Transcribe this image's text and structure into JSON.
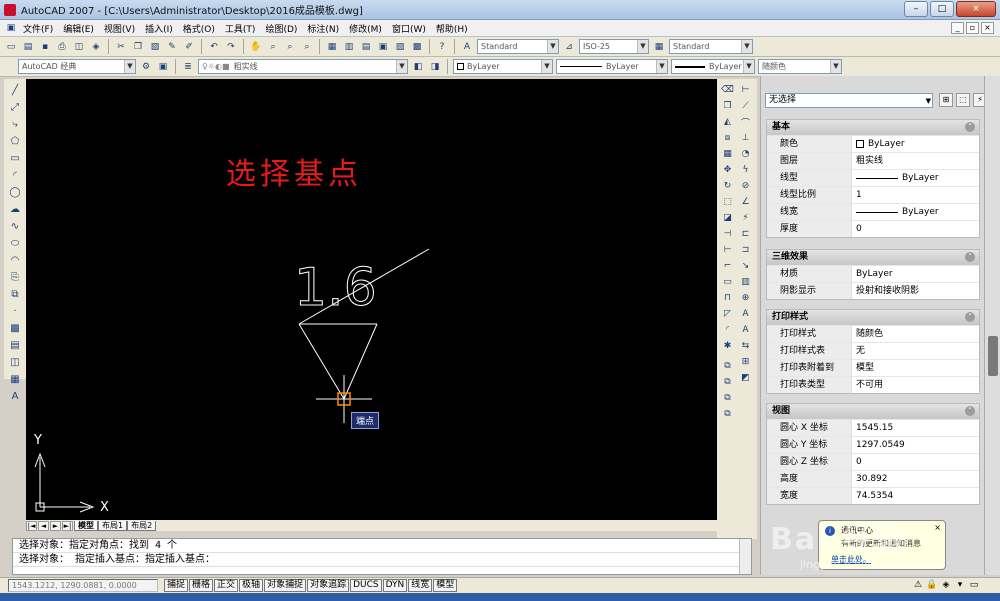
{
  "window": {
    "title": "AutoCAD 2007 - [C:\\Users\\Administrator\\Desktop\\2016成品模板.dwg]",
    "min": "–",
    "max": "□",
    "close": "×"
  },
  "menu": [
    "文件(F)",
    "编辑(E)",
    "视图(V)",
    "插入(I)",
    "格式(O)",
    "工具(T)",
    "绘图(D)",
    "标注(N)",
    "修改(M)",
    "窗口(W)",
    "帮助(H)"
  ],
  "mdi": {
    "min": "_",
    "restore": "▫",
    "close": "×"
  },
  "toolbar": {
    "text_style": "Standard",
    "dim_style": "ISO-25",
    "table_style": "Standard",
    "workspace": "AutoCAD 经典",
    "layer": "粗实线",
    "color": "ByLayer",
    "linetype": "ByLayer",
    "lineweight": "ByLayer",
    "plotstyle": "随颜色"
  },
  "canvas": {
    "overlay_text": "选择基点",
    "drawing_text": "1.6",
    "tooltip": "端点",
    "ucs_y": "Y",
    "ucs_x": "X"
  },
  "layout_tabs": {
    "nav": [
      "|◄",
      "◄",
      "►",
      "►|"
    ],
    "tabs": [
      "模型",
      "布局1",
      "布局2"
    ]
  },
  "command_lines": [
    "选择对象：指定对角点：找到 4 个",
    "选择对象：  指定插入基点：指定插入基点："
  ],
  "status": {
    "coords": "1543.1212, 1290.0881, 0.0000",
    "buttons": [
      "捕捉",
      "栅格",
      "正交",
      "极轴",
      "对象捕捉",
      "对象追踪",
      "DUCS",
      "DYN",
      "线宽",
      "模型"
    ]
  },
  "properties": {
    "selection": "无选择",
    "sections": [
      {
        "title": "基本",
        "rows": [
          {
            "k": "颜色",
            "v": "ByLayer",
            "type": "color"
          },
          {
            "k": "图层",
            "v": "粗实线"
          },
          {
            "k": "线型",
            "v": "ByLayer",
            "type": "line"
          },
          {
            "k": "线型比例",
            "v": "1"
          },
          {
            "k": "线宽",
            "v": "ByLayer",
            "type": "line"
          },
          {
            "k": "厚度",
            "v": "0"
          }
        ]
      },
      {
        "title": "三维效果",
        "rows": [
          {
            "k": "材质",
            "v": "ByLayer"
          },
          {
            "k": "阴影显示",
            "v": "投射和接收阴影"
          }
        ]
      },
      {
        "title": "打印样式",
        "rows": [
          {
            "k": "打印样式",
            "v": "随颜色"
          },
          {
            "k": "打印样式表",
            "v": "无"
          },
          {
            "k": "打印表附着到",
            "v": "模型"
          },
          {
            "k": "打印表类型",
            "v": "不可用"
          }
        ]
      },
      {
        "title": "视图",
        "rows": [
          {
            "k": "圆心 X 坐标",
            "v": "1545.15"
          },
          {
            "k": "圆心 Y 坐标",
            "v": "1297.0549"
          },
          {
            "k": "圆心 Z 坐标",
            "v": "0"
          },
          {
            "k": "高度",
            "v": "30.892"
          },
          {
            "k": "宽度",
            "v": "74.5354"
          }
        ]
      }
    ]
  },
  "notification": {
    "title": "通讯中心",
    "body": "有新的更新和通知消息",
    "link": "单击此处。",
    "close": "×"
  },
  "watermark": {
    "main": "Bai 经验",
    "sub": "jingyan.baidu.com"
  },
  "colors": {
    "canvas": "#000000",
    "overlay_text": "#e31b1b",
    "geometry": "#ffffff",
    "osnap_marker": "#ff8c00"
  }
}
